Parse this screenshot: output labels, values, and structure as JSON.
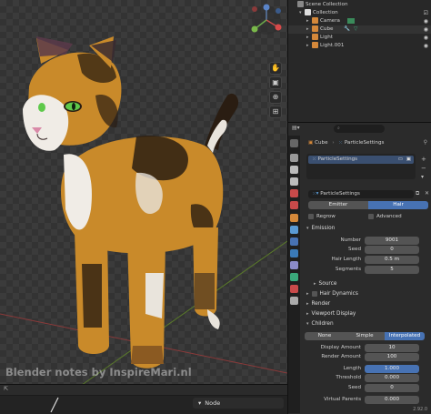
{
  "viewport": {
    "watermark": "Blender notes by InspireMari.nl",
    "timeline_mode": "Node"
  },
  "outliner": {
    "rows": [
      {
        "name": "Scene Collection"
      },
      {
        "name": "Collection"
      },
      {
        "name": "Camera"
      },
      {
        "name": "Cube"
      },
      {
        "name": "Light"
      },
      {
        "name": "Light.001"
      }
    ]
  },
  "properties": {
    "breadcrumb_object": "Cube",
    "breadcrumb_system": "ParticleSettings",
    "system_list_item": "ParticleSettings",
    "settings_name": "ParticleSettings",
    "type_tabs": [
      "Emitter",
      "Hair"
    ],
    "regrow_label": "Regrow",
    "advanced_label": "Advanced",
    "emission": {
      "title": "Emission",
      "fields": [
        {
          "label": "Number",
          "value": "9001"
        },
        {
          "label": "Seed",
          "value": "0"
        },
        {
          "label": "Hair Length",
          "value": "0.5 m"
        },
        {
          "label": "Segments",
          "value": "5"
        }
      ],
      "source_label": "Source"
    },
    "sections": [
      "Hair Dynamics",
      "Render",
      "Viewport Display"
    ],
    "children": {
      "title": "Children",
      "modes": [
        "None",
        "Simple",
        "Interpolated"
      ],
      "fields": [
        {
          "label": "Display Amount",
          "value": "10"
        },
        {
          "label": "Render Amount",
          "value": "100"
        },
        {
          "label": "Length",
          "value": "1.000"
        },
        {
          "label": "Threshold",
          "value": "0.000"
        },
        {
          "label": "Seed",
          "value": "0"
        },
        {
          "label": "Virtual Parents",
          "value": "0.000"
        }
      ]
    },
    "version": "2.92.0"
  },
  "colors": {
    "accent": "#4772b3",
    "fur_orange": "#c98a2a",
    "fur_dark": "#2a1d12",
    "eye_green": "#5ec94a"
  }
}
